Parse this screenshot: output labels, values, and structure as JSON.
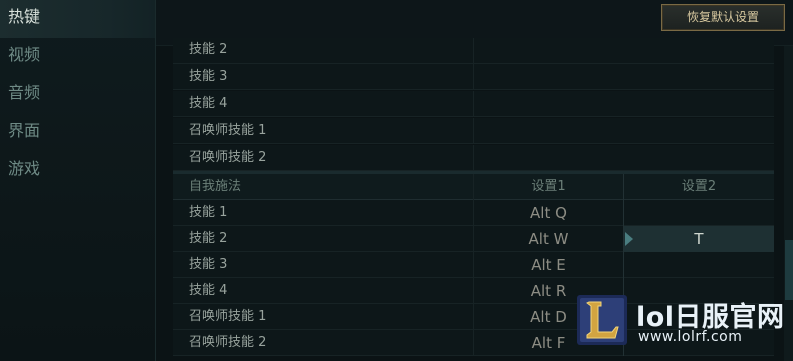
{
  "sidebar": {
    "items": [
      {
        "label": "热键",
        "active": true
      },
      {
        "label": "视频",
        "active": false
      },
      {
        "label": "音频",
        "active": false
      },
      {
        "label": "界面",
        "active": false
      },
      {
        "label": "游戏",
        "active": false
      }
    ]
  },
  "toolbar": {
    "reset_label": "恢复默认设置"
  },
  "table": {
    "upper_rows": [
      {
        "name": "技能 2",
        "key1": "",
        "key2": ""
      },
      {
        "name": "技能 3",
        "key1": "",
        "key2": ""
      },
      {
        "name": "技能 4",
        "key1": "",
        "key2": ""
      },
      {
        "name": "召唤师技能 1",
        "key1": "",
        "key2": ""
      },
      {
        "name": "召唤师技能 2",
        "key1": "",
        "key2": ""
      }
    ],
    "section_header": {
      "name": "自我施法",
      "col1": "设置1",
      "col2": "设置2"
    },
    "lower_rows": [
      {
        "name": "技能 1",
        "key1": "Alt  Q",
        "key2": ""
      },
      {
        "name": "技能 2",
        "key1": "Alt  W",
        "key2": "T",
        "selected": true
      },
      {
        "name": "技能 3",
        "key1": "Alt  E",
        "key2": ""
      },
      {
        "name": "技能 4",
        "key1": "Alt  R",
        "key2": ""
      },
      {
        "name": "召唤师技能 1",
        "key1": "Alt  D",
        "key2": ""
      },
      {
        "name": "召唤师技能 2",
        "key1": "Alt  F",
        "key2": ""
      }
    ]
  },
  "watermark": {
    "title": "lol日服官网",
    "url": "www.lolrf.com",
    "icon": "lol-logo-icon"
  },
  "colors": {
    "accent_gold": "#d8c9a0",
    "selected_cell": "#1e3033",
    "background": "#0b1315"
  }
}
